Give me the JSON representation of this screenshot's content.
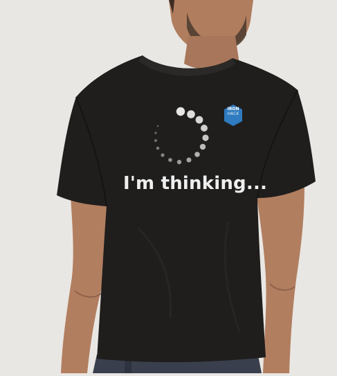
{
  "scene": {
    "background_color": "#e9e7e3",
    "shirt_color": "#1f1e1d",
    "skin_color": "#b07d5e",
    "jeans_color": "#3a3f4d"
  },
  "print": {
    "slogan": "I'm thinking...",
    "spinner_dot_color": "#d9d9d9",
    "spinner_dots": 17
  },
  "badge": {
    "line1": "IRON",
    "line2": "HACK",
    "color": "#2f7bbf"
  }
}
